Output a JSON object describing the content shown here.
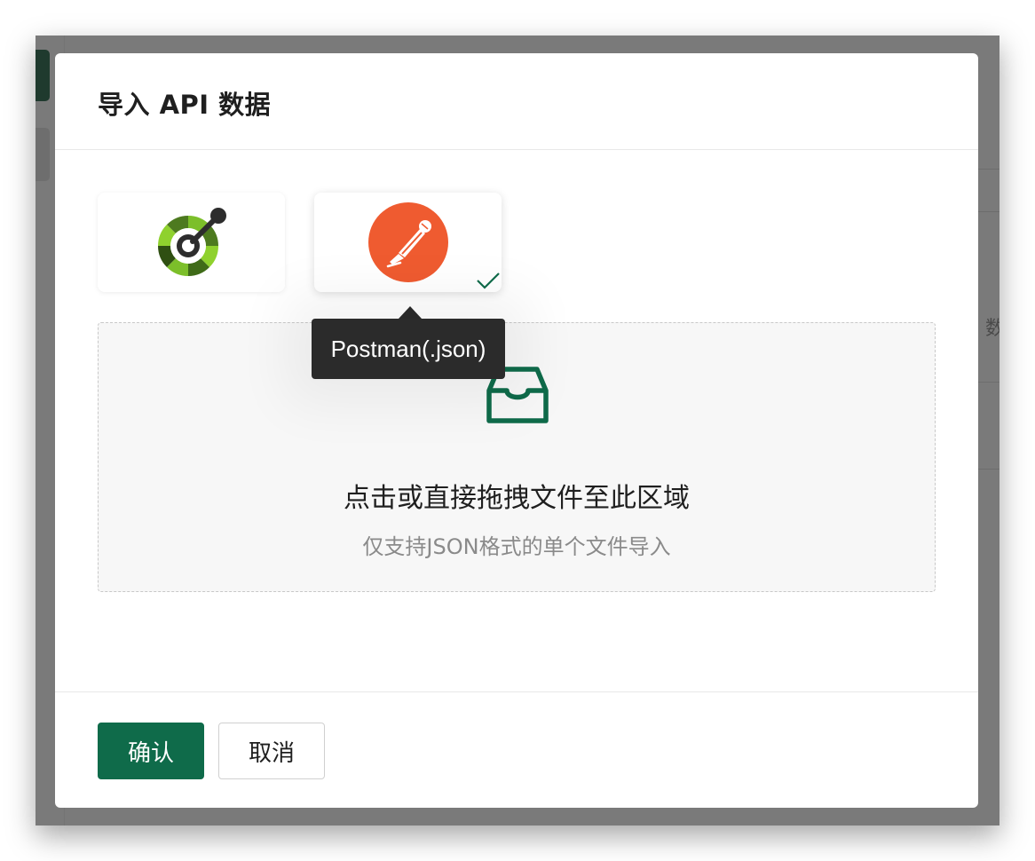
{
  "modal": {
    "title": "导入 API 数据"
  },
  "sources": [
    {
      "id": "openapi",
      "icon": "openapi-logo-icon",
      "selected": false
    },
    {
      "id": "postman",
      "icon": "postman-logo-icon",
      "selected": true
    }
  ],
  "tooltip": {
    "text": "Postman(.json)"
  },
  "dropzone": {
    "title": "点击或直接拖拽文件至此区域",
    "hint": "仅支持JSON格式的单个文件导入",
    "icon": "inbox-icon"
  },
  "footer": {
    "confirm_label": "确认",
    "cancel_label": "取消"
  },
  "background": {
    "partial_text": "数"
  },
  "colors": {
    "primary": "#0f6b4a",
    "postman_orange": "#ef5b30",
    "openapi_green": "#6ba539",
    "tooltip_bg": "#2b2b2b"
  }
}
